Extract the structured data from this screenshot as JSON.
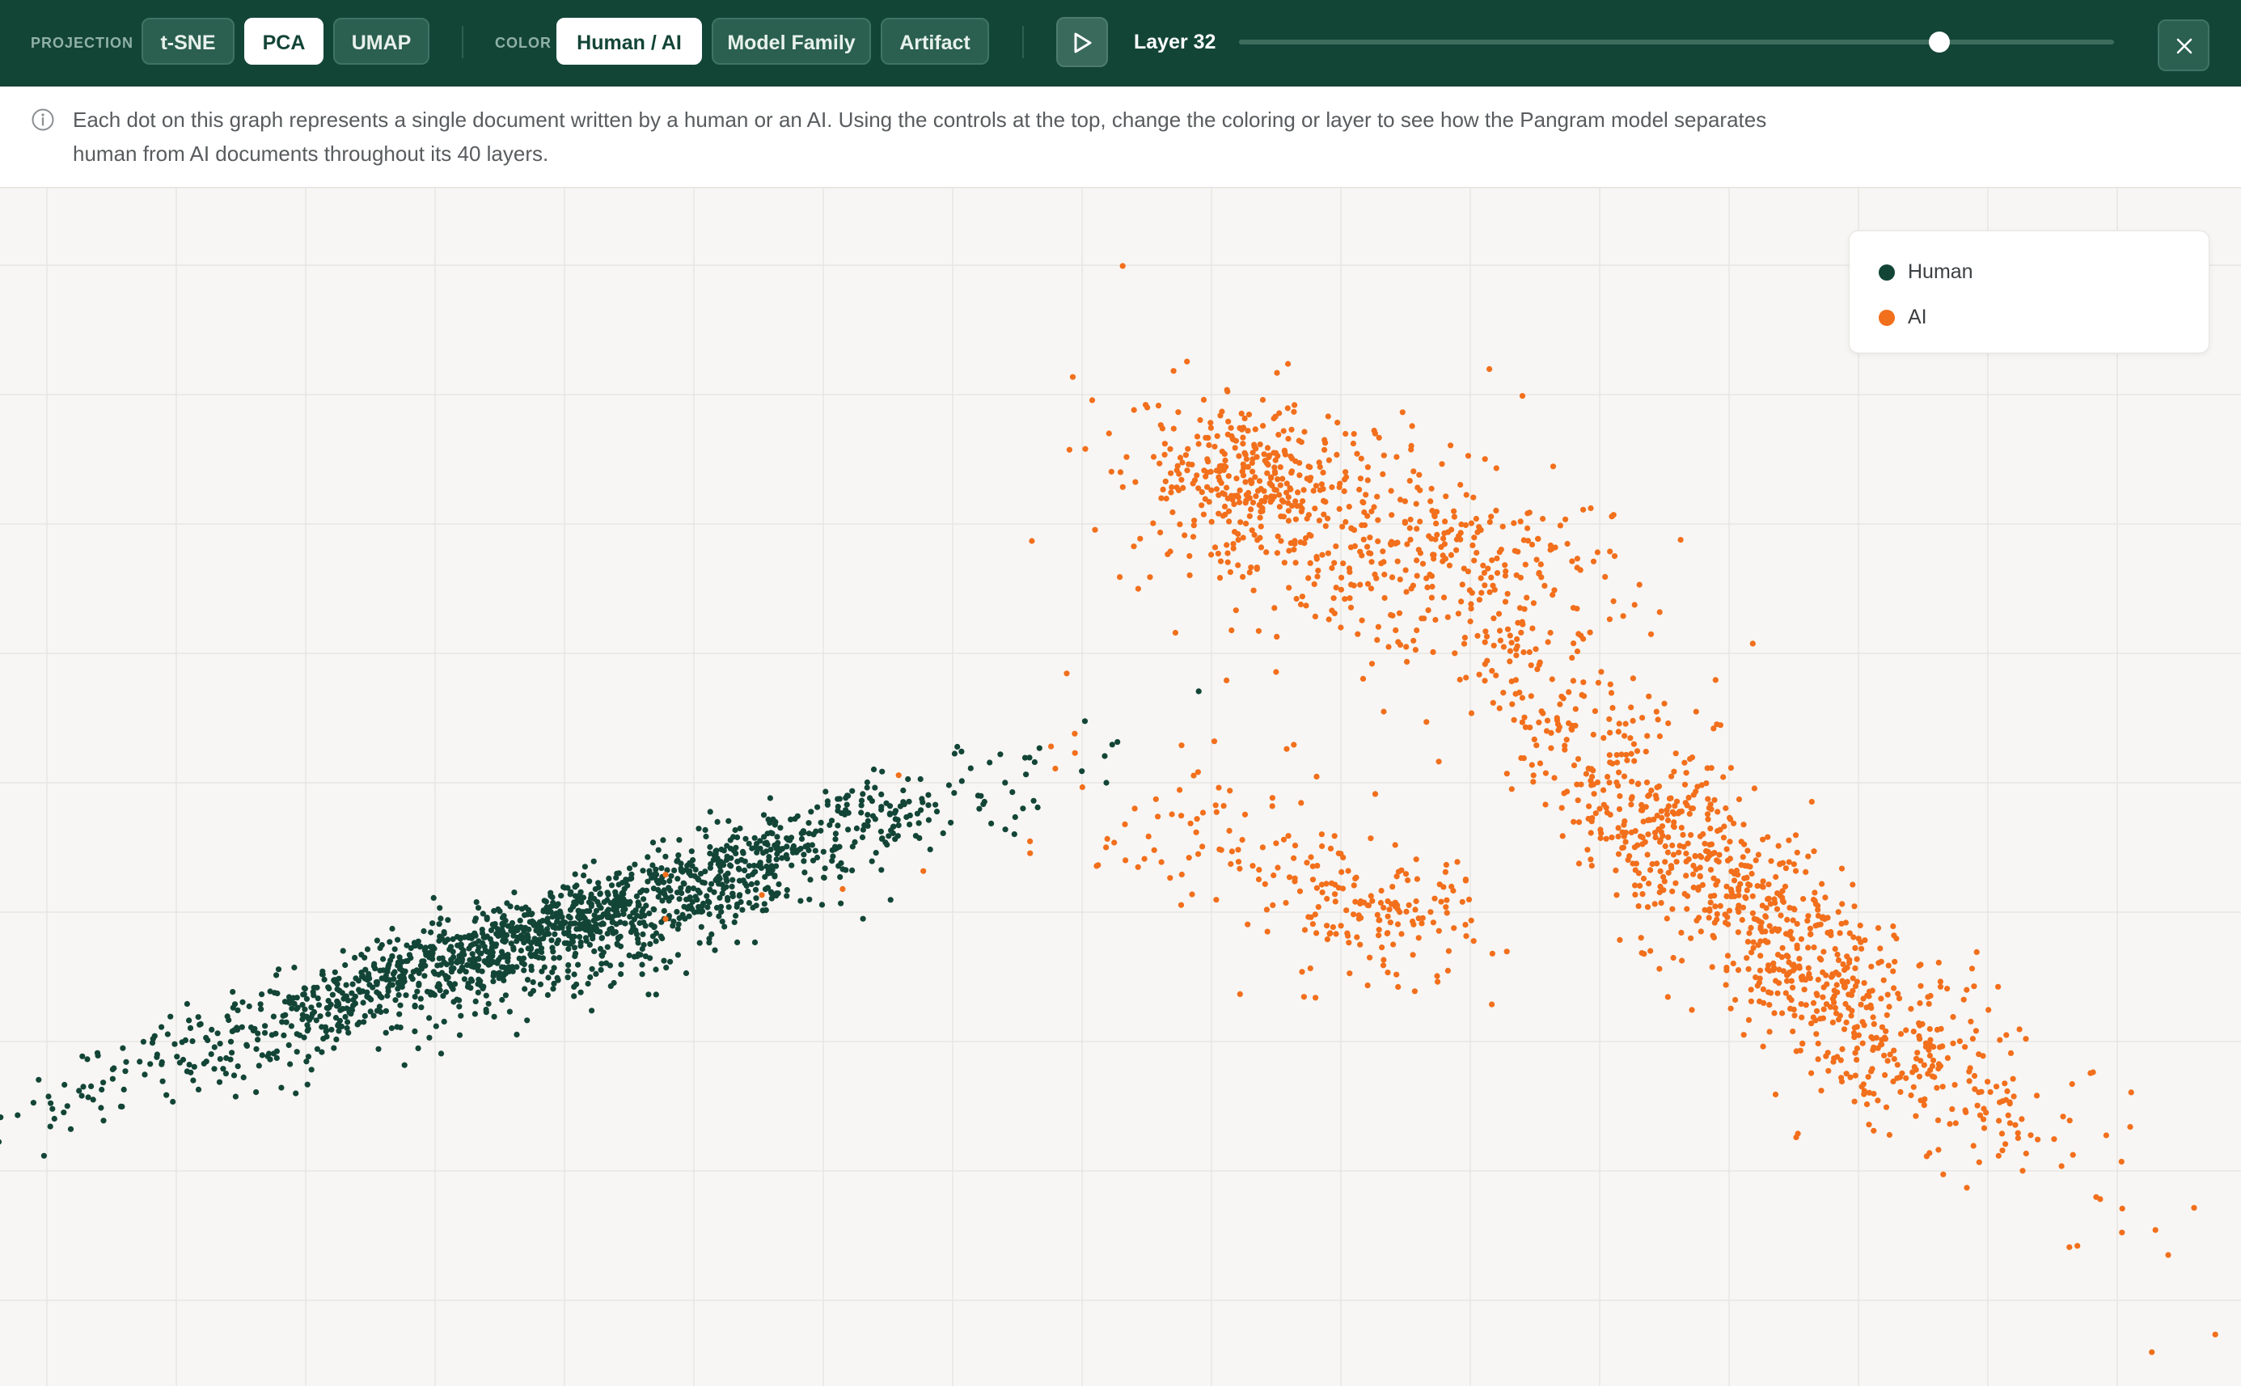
{
  "toolbar": {
    "projection_label": "PROJECTION",
    "projection_options": [
      "t-SNE",
      "PCA",
      "UMAP"
    ],
    "projection_selected": "PCA",
    "color_label": "COLOR",
    "color_options": [
      "Human / AI",
      "Model Family",
      "Artifact"
    ],
    "color_selected": "Human / AI",
    "play_icon": "play-icon",
    "layer_label": "Layer 32",
    "layer_current": 32,
    "layer_max": 40,
    "close_icon": "close-icon"
  },
  "info": {
    "icon": "info-icon",
    "text": "Each dot on this graph represents a single document written by a human or an AI. Using the controls at the top, change the coloring or layer to see how the Pangram model separates human from AI documents throughout its 40 layers."
  },
  "legend": [
    {
      "label": "Human",
      "color": "#134537"
    },
    {
      "label": "AI",
      "color": "#f26f1c"
    }
  ],
  "chart_data": {
    "type": "scatter",
    "title": "",
    "xlabel": "",
    "ylabel": "",
    "grid": true,
    "legend_position": "top-right",
    "xlim": [
      0,
      1
    ],
    "ylim": [
      0,
      1
    ],
    "series": [
      {
        "name": "Human",
        "color": "#134537",
        "clusters": [
          {
            "center": [
              0.235,
              0.375
            ],
            "spread": [
              0.095,
              0.018
            ],
            "slope": 0.34,
            "count": 1300
          },
          {
            "center": [
              0.285,
              0.38
            ],
            "spread": [
              0.06,
              0.025
            ],
            "slope": 0.34,
            "count": 300
          }
        ],
        "outliers": [
          [
            0.426,
            0.528
          ],
          [
            0.453,
            0.475
          ],
          [
            0.437,
            0.482
          ],
          [
            0.41,
            0.47
          ]
        ]
      },
      {
        "name": "AI",
        "color": "#f26f1c",
        "clusters": [
          {
            "center": [
              0.555,
              0.76
            ],
            "spread": [
              0.02,
              0.03
            ],
            "slope": 0.0,
            "count": 220
          },
          {
            "center": [
              0.6,
              0.72
            ],
            "spread": [
              0.05,
              0.05
            ],
            "slope": -0.2,
            "count": 350
          },
          {
            "center": [
              0.65,
              0.67
            ],
            "spread": [
              0.04,
              0.05
            ],
            "slope": 0.0,
            "count": 150
          },
          {
            "center": [
              0.72,
              0.5
            ],
            "spread": [
              0.03,
              0.04
            ],
            "slope": -0.9,
            "count": 220
          },
          {
            "center": [
              0.78,
              0.4
            ],
            "spread": [
              0.035,
              0.05
            ],
            "slope": -0.9,
            "count": 450
          },
          {
            "center": [
              0.845,
              0.3
            ],
            "spread": [
              0.045,
              0.04
            ],
            "slope": -0.7,
            "count": 320
          },
          {
            "center": [
              0.57,
              0.43
            ],
            "spread": [
              0.04,
              0.04
            ],
            "slope": -0.3,
            "count": 140
          },
          {
            "center": [
              0.62,
              0.39
            ],
            "spread": [
              0.02,
              0.025
            ],
            "slope": 0.0,
            "count": 90
          }
        ],
        "outliers": [
          [
            0.476,
            0.595
          ],
          [
            0.469,
            0.534
          ],
          [
            0.483,
            0.5
          ],
          [
            0.502,
            0.469
          ],
          [
            0.49,
            0.435
          ],
          [
            0.934,
            0.262
          ],
          [
            0.927,
            0.117
          ],
          [
            0.925,
            0.193
          ],
          [
            0.297,
            0.427
          ],
          [
            0.401,
            0.51
          ]
        ]
      }
    ]
  }
}
